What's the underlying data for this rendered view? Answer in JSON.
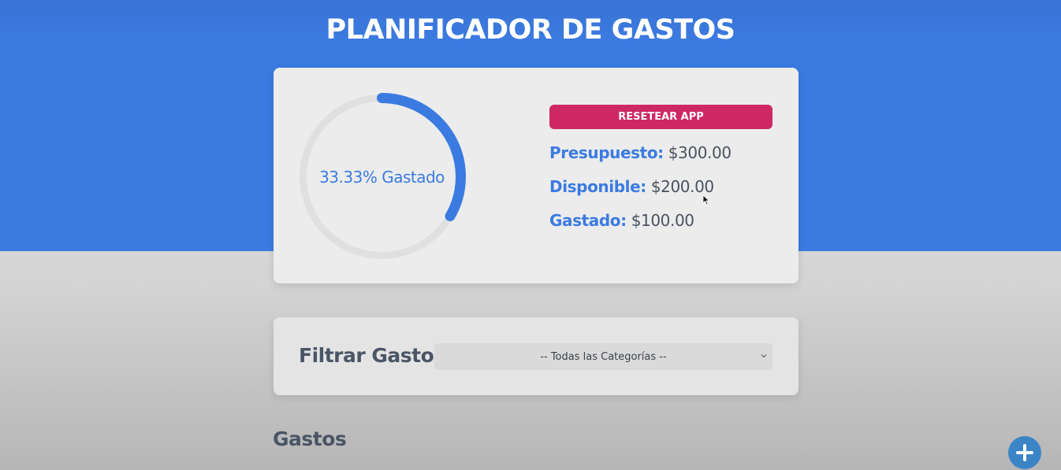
{
  "header": {
    "title": "PLANIFICADOR DE GASTOS",
    "accent_color": "#3b7be1"
  },
  "budget": {
    "progress_percent": 33.33,
    "progress_label": "33.33% Gastado",
    "reset_label": "RESETEAR APP",
    "reset_color": "#cd2863",
    "stats": [
      {
        "label": "Presupuesto:",
        "value": "$300.00"
      },
      {
        "label": "Disponible:",
        "value": "$200.00"
      },
      {
        "label": "Gastado:",
        "value": "$100.00"
      }
    ]
  },
  "filter": {
    "label": "Filtrar Gastos",
    "selected_option": "-- Todas las Categorías --",
    "icon": "chevron-down-icon"
  },
  "expenses": {
    "title": "Gastos"
  },
  "fab": {
    "icon": "plus-icon",
    "color": "#3b85c7"
  }
}
